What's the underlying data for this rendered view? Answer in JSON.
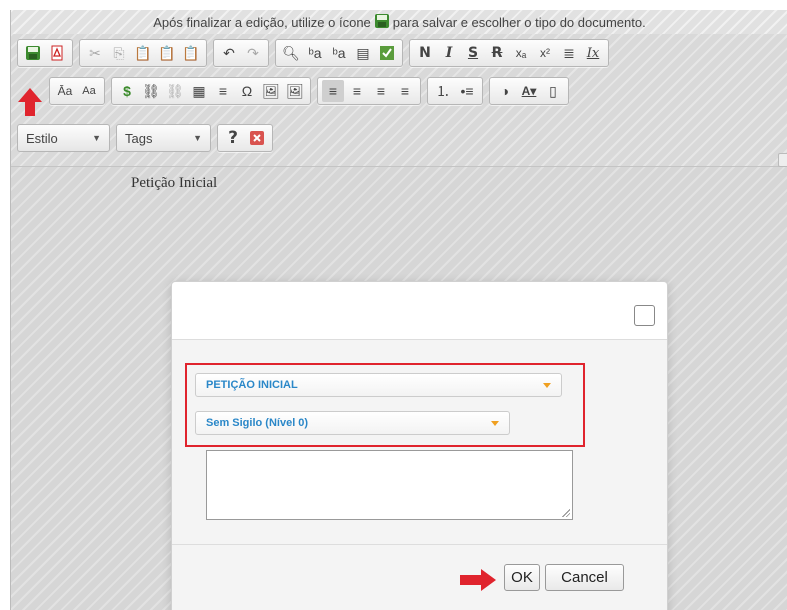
{
  "topbar": {
    "hint_before": "Após finalizar a edição, utilize o ícone",
    "hint_after": "para salvar e escolher o tipo do documento."
  },
  "toolbar": {
    "style_combo": "Estilo",
    "tags_combo": "Tags",
    "bold": "N",
    "italic": "I",
    "underline": "S",
    "strike": "R",
    "subscript": "xₐ",
    "superscript": "x²",
    "remove_format": "Ix",
    "font_size_a": "Aa",
    "help": "?"
  },
  "document": {
    "text": "Petição Inicial"
  },
  "dialog": {
    "document_type": "PETIÇÃO INICIAL",
    "secrecy_level": "Sem Sigilo (Nível 0)",
    "textarea_value": "",
    "ok_label": "OK",
    "cancel_label": "Cancel"
  },
  "colors": {
    "highlight_border": "#e0242d",
    "select_text": "#2a87c8",
    "caret": "#f0a020",
    "arrow": "#e0242d"
  }
}
